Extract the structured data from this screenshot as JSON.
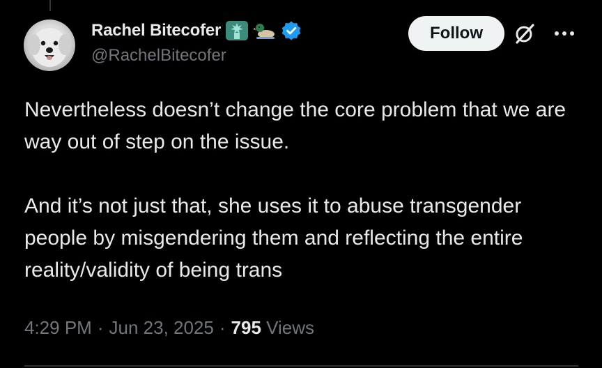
{
  "author": {
    "display_name": "Rachel Bitecofer",
    "handle": "@RachelBitecofer",
    "avatar_icon": "dog-avatar",
    "name_emojis": [
      "statue-of-liberty-icon",
      "duck-icon"
    ],
    "verified": true,
    "verified_color": "#1d9bf0"
  },
  "actions": {
    "follow_label": "Follow",
    "grok_icon": "grok-icon",
    "more_icon": "more-options-icon"
  },
  "tweet": {
    "paragraphs": [
      "Nevertheless doesn’t change the core problem that we are way out of step on the issue.",
      "And it’s not just that, she uses it to abuse transgender people by misgendering them and reflecting the entire reality/validity of being trans"
    ]
  },
  "meta": {
    "time": "4:29 PM",
    "separator": "·",
    "date": "Jun 23, 2025",
    "views_count": "795",
    "views_label": "Views"
  },
  "colors": {
    "background": "#000000",
    "text_primary": "#e7e9ea",
    "text_secondary": "#71767b",
    "follow_bg": "#eff3f4",
    "follow_text": "#0f1419"
  }
}
